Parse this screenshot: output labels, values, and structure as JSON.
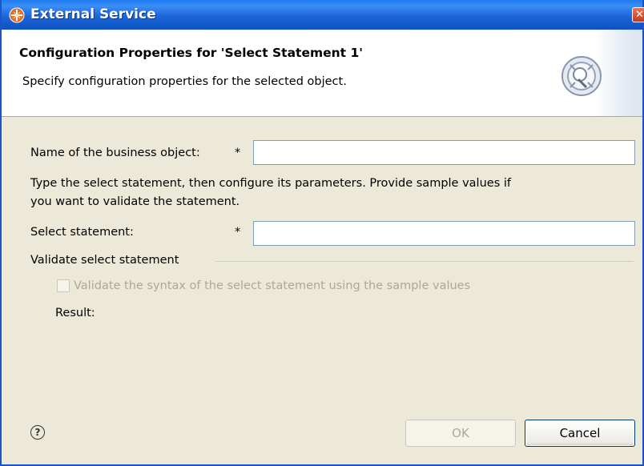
{
  "window": {
    "title": "External Service",
    "close_glyph": "✕"
  },
  "header": {
    "title": "Configuration Properties for 'Select Statement 1'",
    "description": "Specify configuration properties for the selected object.",
    "icon": "wizard-gear-icon"
  },
  "form": {
    "business_object_label": "Name of the business object:",
    "business_object_required": "*",
    "business_object_value": "",
    "instructions_line1": "Type the select statement, then configure its parameters. Provide sample values if",
    "instructions_line2": "you want to validate the statement.",
    "select_statement_label": "Select statement:",
    "select_statement_required": "*",
    "select_statement_value": "",
    "validate_group_label": "Validate select statement",
    "validate_checkbox_label": "Validate the syntax of the select statement using the sample values",
    "validate_checked": false,
    "result_label": "Result:"
  },
  "footer": {
    "help_glyph": "?",
    "ok_label": "OK",
    "cancel_label": "Cancel"
  },
  "colors": {
    "titlebar": "#0e51c3",
    "dialog_bg": "#ece9d8",
    "disabled_text": "#aca899"
  }
}
